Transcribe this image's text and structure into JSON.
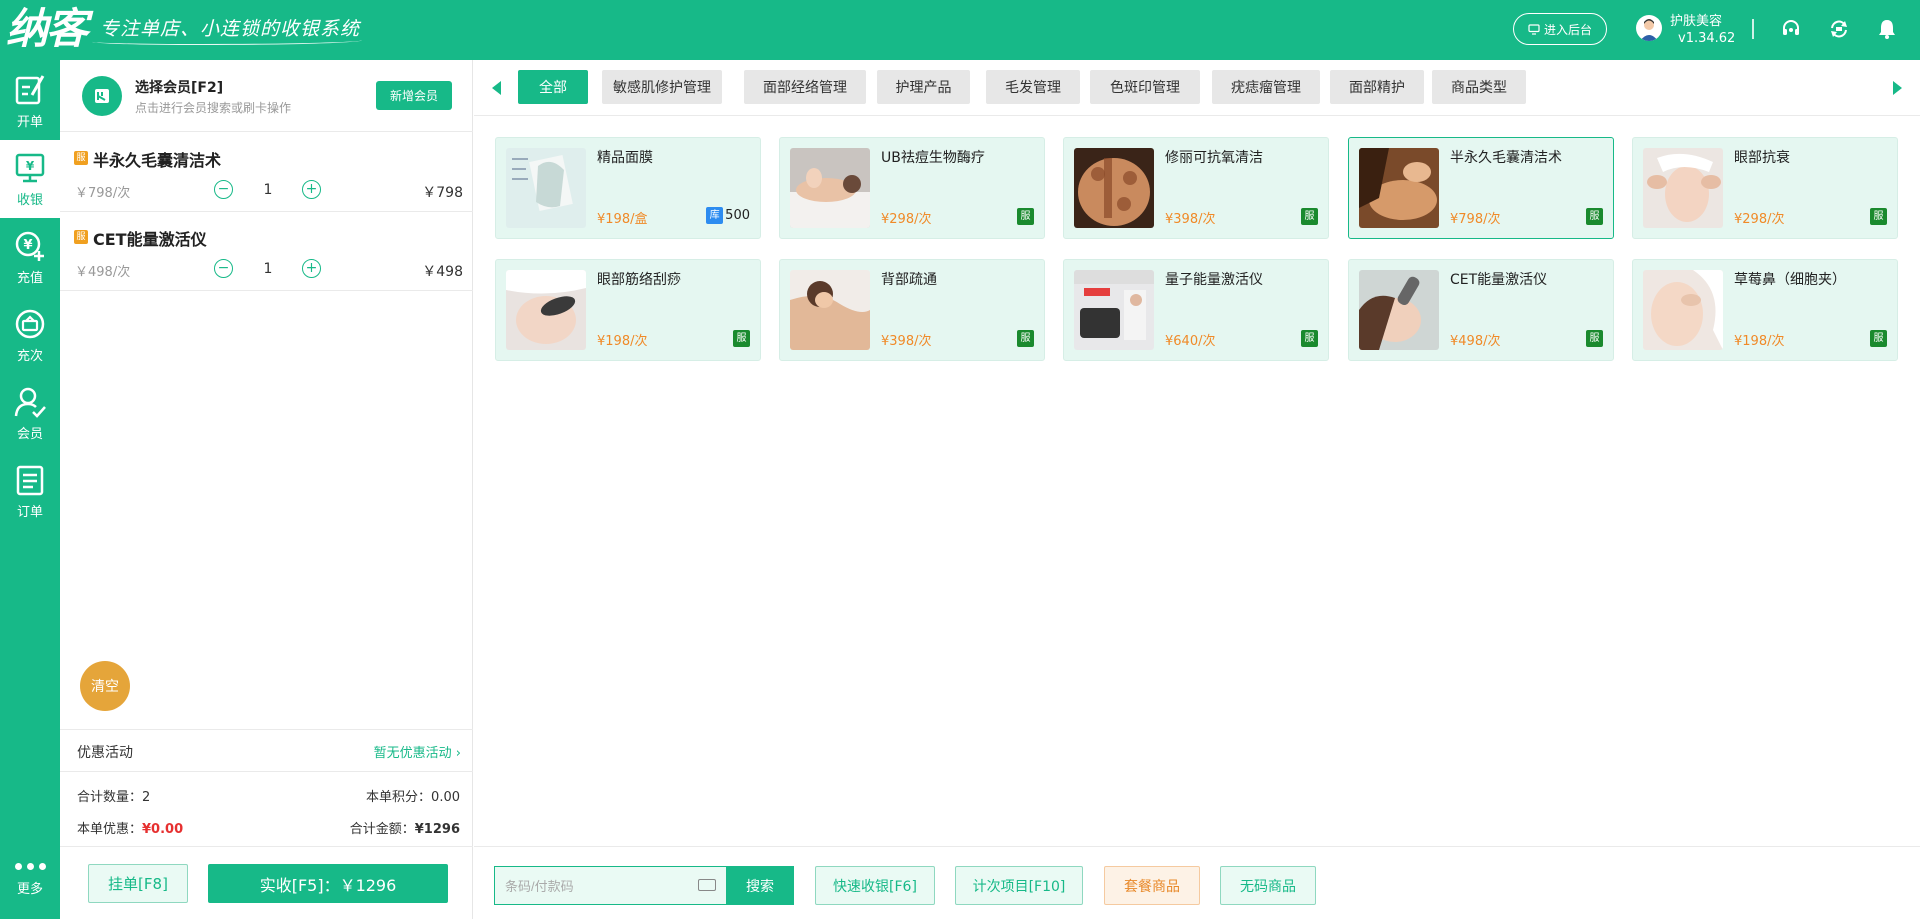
{
  "header": {
    "logo": "纳客",
    "slogan": "专注单店、小连锁的收银系统",
    "admin_button": "进入后台",
    "user_name": "护肤美容",
    "version": "v1.34.62"
  },
  "nav": {
    "items": [
      {
        "label": "开单",
        "icon": "edit-icon"
      },
      {
        "label": "收银",
        "icon": "cashier-icon",
        "active": true
      },
      {
        "label": "充值",
        "icon": "recharge-icon"
      },
      {
        "label": "充次",
        "icon": "count-recharge-icon"
      },
      {
        "label": "会员",
        "icon": "member-icon"
      },
      {
        "label": "订单",
        "icon": "order-icon"
      }
    ],
    "more": "更多"
  },
  "cart": {
    "member_title": "选择会员[F2]",
    "member_sub": "点击进行会员搜索或刷卡操作",
    "new_member": "新增会员",
    "items": [
      {
        "badge": "服",
        "name": "半永久毛囊清洁术",
        "unit": "￥798/次",
        "qty": "1",
        "total": "￥798"
      },
      {
        "badge": "服",
        "name": "CET能量激活仪",
        "unit": "￥498/次",
        "qty": "1",
        "total": "￥498"
      }
    ],
    "minus": "−",
    "plus": "+",
    "clear": "清空",
    "promo_label": "优惠活动",
    "promo_value": "暂无优惠活动",
    "count_label": "合计数量：",
    "count_value": "2",
    "points_label": "本单积分：",
    "points_value": "0.00",
    "discount_label": "本单优惠：",
    "discount_value": "¥0.00",
    "amount_label": "合计金额：",
    "amount_value": "¥1296",
    "hold_button": "挂单[F8]",
    "pay_button": "实收[F5]：￥1296"
  },
  "tabs": [
    {
      "label": "全部",
      "active": true
    },
    {
      "label": "敏感肌修护管理"
    },
    {
      "label": "面部经络管理"
    },
    {
      "label": "护理产品"
    },
    {
      "label": "毛发管理"
    },
    {
      "label": "色斑印管理"
    },
    {
      "label": "疣痣瘤管理"
    },
    {
      "label": "面部精护"
    },
    {
      "label": "商品类型"
    }
  ],
  "products": [
    {
      "name": "精品面膜",
      "price": "¥198/盒",
      "stock_badge": "库",
      "stock": "500"
    },
    {
      "name": "UB祛痘生物酶疗",
      "price": "¥298/次",
      "tag": "服"
    },
    {
      "name": "修丽可抗氧清洁",
      "price": "¥398/次",
      "tag": "服"
    },
    {
      "name": "半永久毛囊清洁术",
      "price": "¥798/次",
      "tag": "服",
      "selected": true
    },
    {
      "name": "眼部抗衰",
      "price": "¥298/次",
      "tag": "服"
    },
    {
      "name": "眼部筋络刮痧",
      "price": "¥198/次",
      "tag": "服"
    },
    {
      "name": "背部疏通",
      "price": "¥398/次",
      "tag": "服"
    },
    {
      "name": "量子能量激活仪",
      "price": "¥640/次",
      "tag": "服"
    },
    {
      "name": "CET能量激活仪",
      "price": "¥498/次",
      "tag": "服"
    },
    {
      "name": "草莓鼻（细胞夹）",
      "price": "¥198/次",
      "tag": "服"
    }
  ],
  "bottom": {
    "search_placeholder": "条码/付款码",
    "search_button": "搜索",
    "quick_cash": "快速收银[F6]",
    "count_item": "计次项目[F10]",
    "package": "套餐商品",
    "no_code": "无码商品"
  },
  "colors": {
    "primary": "#17b988",
    "price": "#f08a28",
    "accent_orange": "#e5a53a"
  }
}
